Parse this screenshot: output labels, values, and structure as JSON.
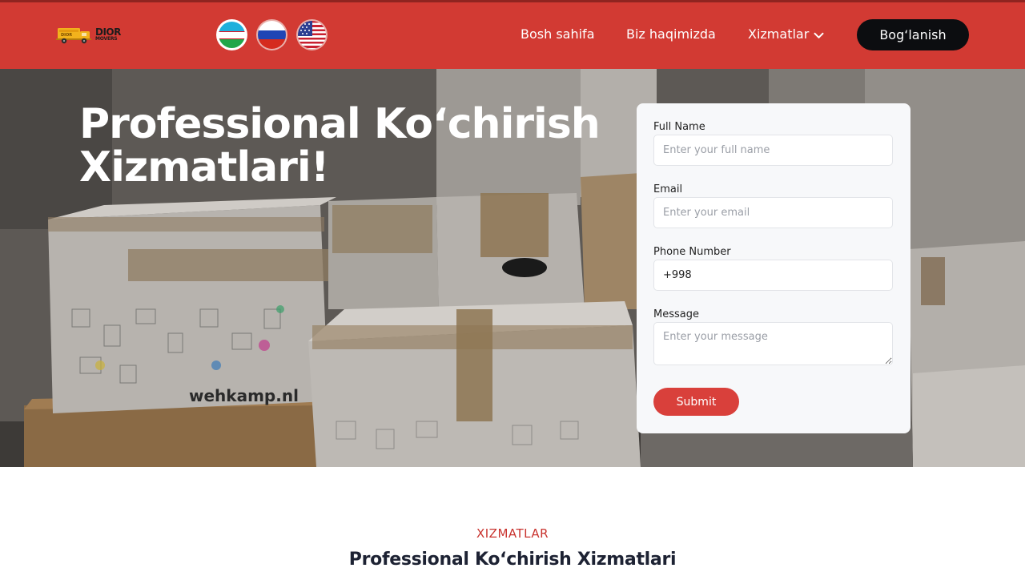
{
  "header": {
    "logo": {
      "main": "DIOR",
      "sub": "MOVERS",
      "icon": "truck-icon"
    },
    "languages": [
      {
        "code": "uz",
        "icon": "flag-uz-icon",
        "active": true
      },
      {
        "code": "ru",
        "icon": "flag-ru-icon",
        "active": false
      },
      {
        "code": "en",
        "icon": "flag-us-icon",
        "active": false
      }
    ],
    "nav": {
      "home": "Bosh sahifa",
      "about": "Biz haqimizda",
      "services": "Xizmatlar",
      "services_icon": "chevron-down-icon",
      "contact": "Bog‘lanish"
    },
    "colors": {
      "header_bg": "#d23a33",
      "contact_bg": "#0c0d10"
    }
  },
  "hero": {
    "title_line1": "Professional Ko‘chirish",
    "title_line2": "Xizmatlari!",
    "image_text": "wehkamp.nl"
  },
  "form": {
    "full_name": {
      "label": "Full Name",
      "placeholder": "Enter your full name",
      "value": ""
    },
    "email": {
      "label": "Email",
      "placeholder": "Enter your email",
      "value": ""
    },
    "phone": {
      "label": "Phone Number",
      "placeholder": "",
      "value": "+998"
    },
    "message": {
      "label": "Message",
      "placeholder": "Enter your message",
      "value": ""
    },
    "submit": "Submit",
    "colors": {
      "submit_bg": "#d9403b",
      "card_bg": "#f7f8fa"
    }
  },
  "services_section": {
    "kicker": "XIZMATLAR",
    "title": "Professional Ko‘chirish Xizmatlari"
  }
}
